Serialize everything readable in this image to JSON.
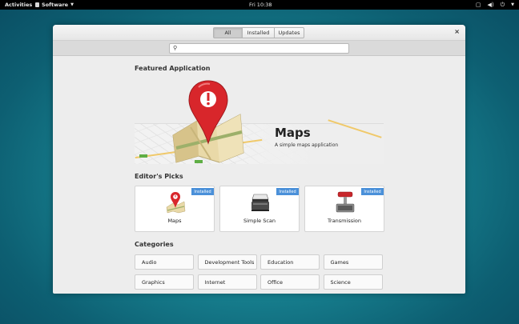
{
  "topbar": {
    "activities": "Activities",
    "app_menu": "Software",
    "clock": "Fri 10:38"
  },
  "header": {
    "tabs": [
      {
        "label": "All",
        "active": true
      },
      {
        "label": "Installed",
        "active": false
      },
      {
        "label": "Updates",
        "active": false
      }
    ],
    "close": "×"
  },
  "search": {
    "placeholder": "",
    "value": ""
  },
  "featured": {
    "section_title": "Featured Application",
    "app_name": "Maps",
    "app_description": "A simple maps application"
  },
  "editors_picks": {
    "section_title": "Editor's Picks",
    "items": [
      {
        "label": "Maps",
        "badge": "Installed",
        "icon": "maps-icon"
      },
      {
        "label": "Simple Scan",
        "badge": "Installed",
        "icon": "scanner-icon"
      },
      {
        "label": "Transmission",
        "badge": "Installed",
        "icon": "transmission-icon"
      }
    ]
  },
  "categories": {
    "section_title": "Categories",
    "items": [
      "Audio",
      "Development Tools",
      "Education",
      "Games",
      "Graphics",
      "Internet",
      "Office",
      "Science"
    ]
  },
  "colors": {
    "accent": "#4a90d9",
    "desktop": "#17808f",
    "pin_red": "#d8262b"
  }
}
